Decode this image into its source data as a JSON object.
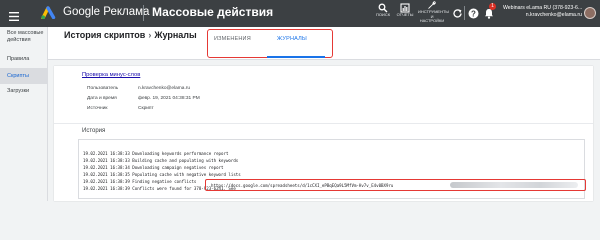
{
  "topbar": {
    "brand": "Google Реклама",
    "page_title": "Массовые действия",
    "tools": [
      {
        "icon": "search-icon",
        "label": "ПОИСК"
      },
      {
        "icon": "reports-icon",
        "label": "ОТЧЕТЫ"
      },
      {
        "icon": "wrench-icon",
        "label1": "ИНСТРУМЕНТЫ",
        "label2": "И",
        "label3": "НАСТРОЙКИ"
      }
    ],
    "notif_count": "1",
    "account": {
      "name": "Webinars eLama RU (378-923-6...",
      "email": "n.kravchenko@elama.ru"
    }
  },
  "sidebar": {
    "items": [
      {
        "label1": "Все массовые",
        "label2": "действия"
      },
      {
        "label": "Правила"
      },
      {
        "label": "Скрипты"
      },
      {
        "label": "Загрузки"
      }
    ]
  },
  "header": {
    "breadcrumb_parent": "История скриптов",
    "breadcrumb_sep": "›",
    "breadcrumb_current": "Журналы",
    "tabs": [
      {
        "label": "ИЗМЕНЕНИЯ"
      },
      {
        "label": "ЖУРНАЛЫ"
      }
    ]
  },
  "details": {
    "script_link": "Проверка минус-слов",
    "rows": [
      {
        "key": "Пользователь",
        "value": "n.kravchenko@elama.ru"
      },
      {
        "key": "Дата и время",
        "value": "февр. 19, 2021 04:38:31 PM"
      },
      {
        "key": "Источник",
        "value": "Скрипт"
      }
    ]
  },
  "history": {
    "title": "История",
    "lines": [
      "19.02.2021 16:38:33  Downloading keywords performance report",
      "19.02.2021 16:38:33  Building cache and populating with keywords",
      "19.02.2021 16:38:34  Downloading campaign negatives report",
      "19.02.2021 16:38:35  Populating cache with negative keyword lists",
      "19.02.2021 16:38:39  Finding negative conflicts",
      "19.02.2021 16:38:39  Conflicts were found for 378-923-6241. See"
    ],
    "url": "https://docs.google.com/spreadsheets/d/1cCXI_ePBqEQa9L5MfVm-Hv7v_E4v0BX9ru"
  }
}
